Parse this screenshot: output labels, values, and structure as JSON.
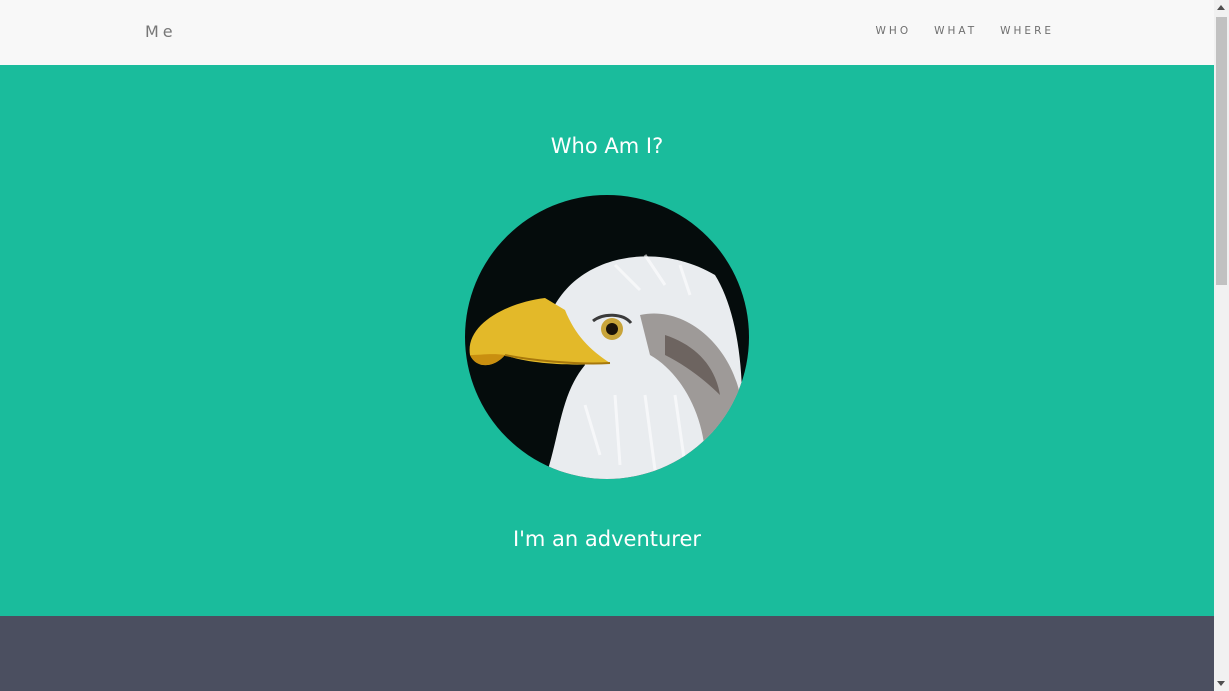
{
  "navbar": {
    "brand": "Me",
    "links": [
      "WHO",
      "WHAT",
      "WHERE"
    ]
  },
  "hero": {
    "title": "Who Am I?",
    "subtitle": "I'm an adventurer",
    "avatar_icon": "eagle-avatar-image"
  },
  "colors": {
    "hero_bg": "#1abc9c",
    "nav_bg": "#f8f8f8",
    "dark_section_bg": "#4b4f60"
  }
}
